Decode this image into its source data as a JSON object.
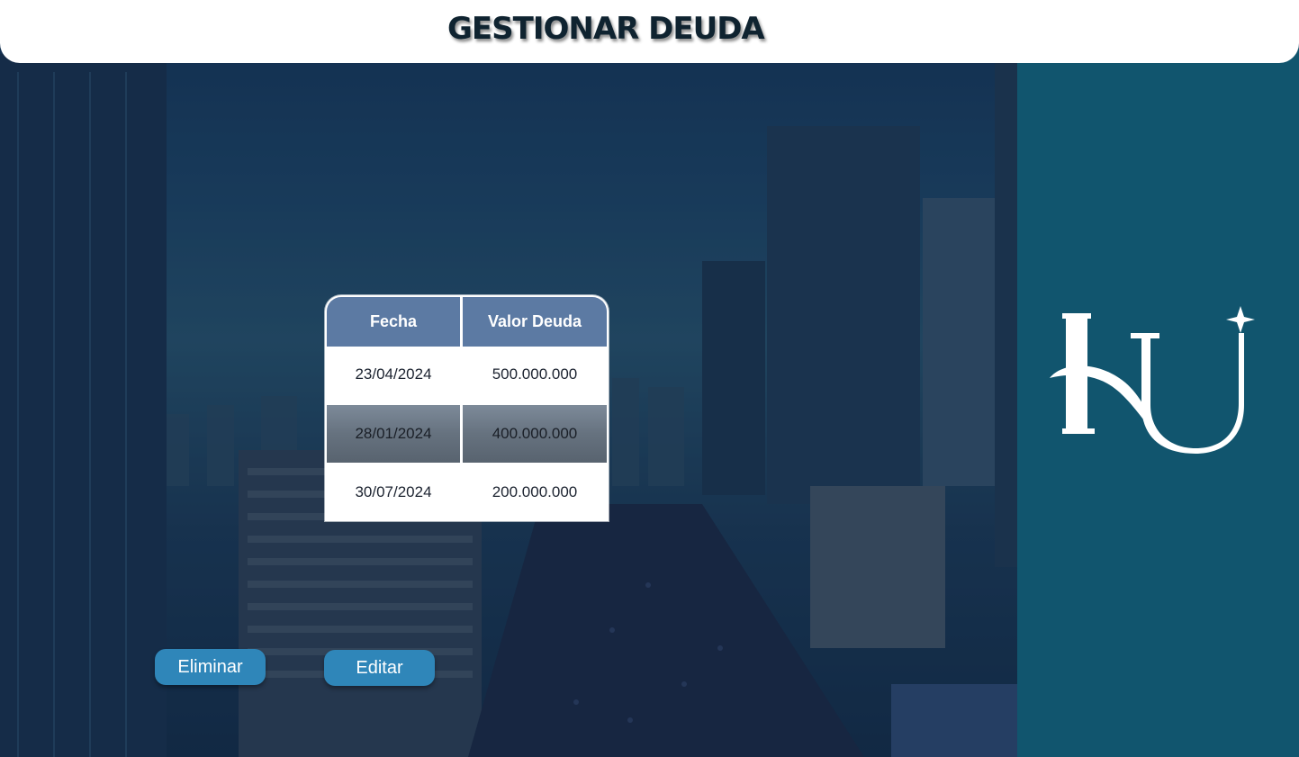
{
  "header": {
    "title": "GESTIONAR DEUDA"
  },
  "table": {
    "columns": [
      "Fecha",
      "Valor Deuda"
    ],
    "rows": [
      {
        "fecha": "23/04/2024",
        "valor": "500.000.000"
      },
      {
        "fecha": "28/01/2024",
        "valor": "400.000.000"
      },
      {
        "fecha": "30/07/2024",
        "valor": "200.000.000"
      }
    ]
  },
  "actions": {
    "delete_label": "Eliminar",
    "edit_label": "Editar"
  },
  "logo": {
    "icon": "hu-logo-icon"
  },
  "colors": {
    "header_bg": "#ffffff",
    "table_header": "#5c7aa3",
    "button": "#2f86b9",
    "side_panel": "#11556e"
  }
}
